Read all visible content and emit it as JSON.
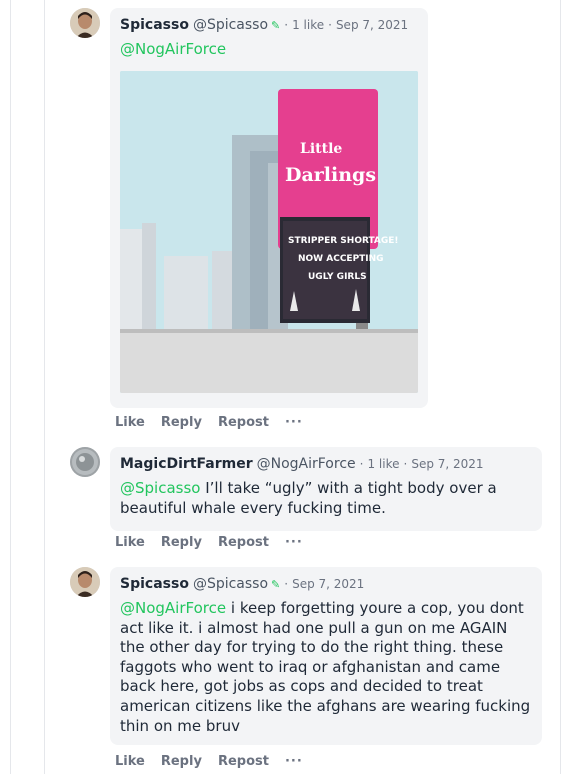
{
  "comments": [
    {
      "author": "Spicasso",
      "handle": "@Spicasso",
      "likes": "1 like",
      "date": "Sep 7, 2021",
      "mention": "@NogAirForce",
      "text": "",
      "has_image": true,
      "image_sign": {
        "line1": "Little",
        "line2": "Darlings",
        "line3": "STRIPPER SHORTAGE!",
        "line4": "NOW ACCEPTING",
        "line5": "UGLY GIRLS"
      }
    },
    {
      "author": "MagicDirtFarmer",
      "handle": "@NogAirForce",
      "likes": "1 like",
      "date": "Sep 7, 2021",
      "mention": "@Spicasso",
      "text": " I’ll take “ugly” with a tight body over a beautiful whale every fucking time."
    },
    {
      "author": "Spicasso",
      "handle": "@Spicasso",
      "likes": "",
      "date": "Sep 7, 2021",
      "mention": "@NogAirForce",
      "text": " i keep forgetting youre a cop, you dont act like it. i almost had one pull a gun on me AGAIN the other day for trying to do the right thing. these faggots who went to iraq or afghanistan and came back here, got jobs as cops and decided to treat american citizens like the afghans are wearing fucking thin on me bruv"
    }
  ],
  "actions": {
    "like": "Like",
    "reply": "Reply",
    "repost": "Repost",
    "more": "···"
  },
  "separator": "·",
  "colors": {
    "mention": "#22c55e",
    "bubble": "#f3f4f6",
    "meta": "#6b7280"
  }
}
